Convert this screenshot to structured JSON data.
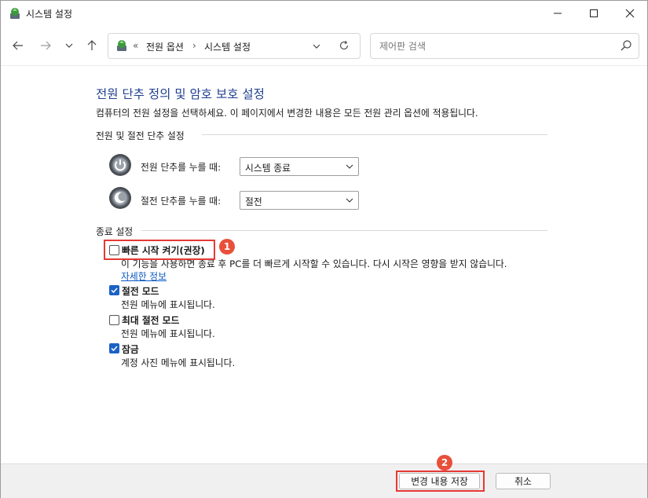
{
  "window": {
    "title": "시스템 설정",
    "controls": {
      "minimize": "—",
      "maximize": "☐",
      "close": "✕"
    }
  },
  "nav": {
    "breadcrumb_prefix": "«",
    "breadcrumb": [
      "전원 옵션",
      "시스템 설정"
    ],
    "breadcrumb_sep": "›",
    "search_placeholder": "제어판 검색"
  },
  "main": {
    "title": "전원 단추 정의 및 암호 보호 설정",
    "description": "컴퓨터의 전원 설정을 선택하세요. 이 페이지에서 변경한 내용은 모든 전원 관리 옵션에 적용됩니다.",
    "power_section": {
      "heading": "전원 및 절전 단추 설정",
      "rows": [
        {
          "label": "전원 단추를 누를 때:",
          "value": "시스템 종료"
        },
        {
          "label": "절전 단추를 누를 때:",
          "value": "절전"
        }
      ]
    },
    "shutdown_section": {
      "heading": "종료 설정",
      "options": [
        {
          "label": "빠른 시작 켜기(권장)",
          "checked": false,
          "description": "이 기능을 사용하면 종료 후 PC를 더 빠르게 시작할 수 있습니다. 다시 시작은 영향을 받지 않습니다.",
          "link": "자세한 정보"
        },
        {
          "label": "절전 모드",
          "checked": true,
          "description": "전원 메뉴에 표시됩니다."
        },
        {
          "label": "최대 절전 모드",
          "checked": false,
          "description": "전원 메뉴에 표시됩니다."
        },
        {
          "label": "잠금",
          "checked": true,
          "description": "계정 사진 메뉴에 표시됩니다."
        }
      ]
    }
  },
  "annotations": {
    "badge1": "1",
    "badge2": "2",
    "color": "#e53935"
  },
  "footer": {
    "save": "변경 내용 저장",
    "cancel": "취소"
  },
  "colors": {
    "title": "#1f3f8f",
    "link": "#0a58c2",
    "checkbox": "#1b62c7"
  }
}
